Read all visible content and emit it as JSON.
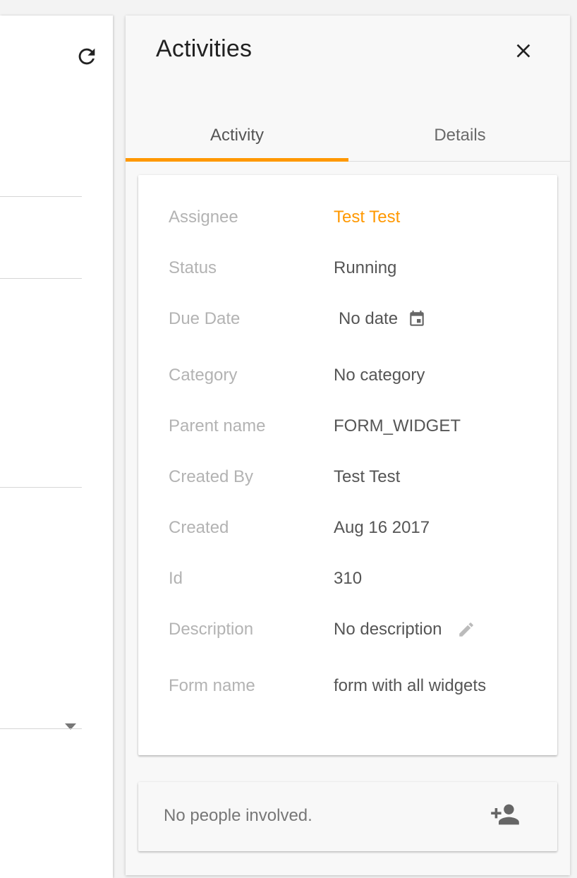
{
  "drawer": {
    "title": "Activities",
    "tabs": [
      {
        "label": "Activity",
        "active": true
      },
      {
        "label": "Details",
        "active": false
      }
    ]
  },
  "details": {
    "assignee": {
      "label": "Assignee",
      "value": "Test Test"
    },
    "status": {
      "label": "Status",
      "value": "Running"
    },
    "due_date": {
      "label": "Due Date",
      "value": "No date"
    },
    "category": {
      "label": "Category",
      "value": "No category"
    },
    "parent_name": {
      "label": "Parent name",
      "value": "FORM_WIDGET"
    },
    "created_by": {
      "label": "Created By",
      "value": "Test Test"
    },
    "created": {
      "label": "Created",
      "value": "Aug 16 2017"
    },
    "id": {
      "label": "Id",
      "value": "310"
    },
    "description": {
      "label": "Description",
      "value": "No description"
    },
    "form_name": {
      "label": "Form name",
      "value": "form with all widgets"
    }
  },
  "people": {
    "empty_text": "No people involved."
  },
  "icons": {
    "refresh": "refresh-icon",
    "close": "close-icon",
    "calendar": "calendar-icon",
    "edit": "pencil-icon",
    "add_person": "person-add-icon",
    "dropdown": "chevron-down-icon"
  },
  "colors": {
    "accent": "#ff9800",
    "label": "#b3b3b3",
    "value": "#555555"
  }
}
